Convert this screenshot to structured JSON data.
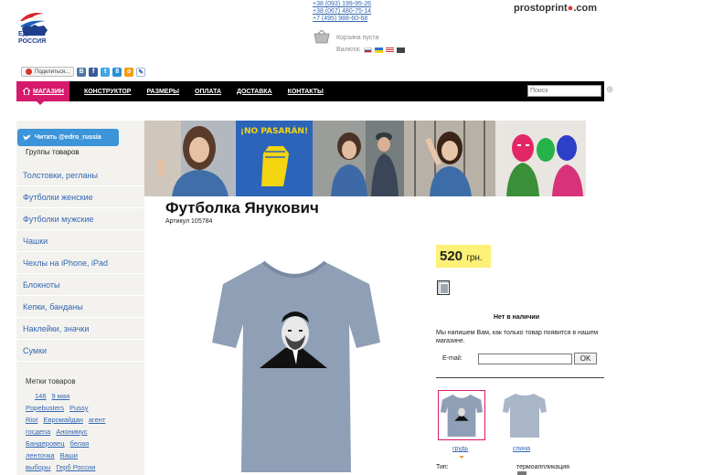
{
  "header": {
    "logo_text": "ЕДИНАЯ РОССИЯ",
    "phones": [
      "+38 (093) 199-95-26",
      "+38 (067) 480-75-14",
      "+7 (495) 988-60-68"
    ],
    "brand": "prostoprint",
    "brand_tld": ".com",
    "cart": "Корзина пуста",
    "currency_label": "Валюта:"
  },
  "share": {
    "label": "Поделиться...",
    "networks": [
      "vk",
      "facebook",
      "twitter",
      "google",
      "odnoklassniki",
      "livejournal"
    ]
  },
  "nav": {
    "items": [
      "МАГАЗИН",
      "КОНСТРУКТОР",
      "РАЗМЕРЫ",
      "ОПЛАТА",
      "ДОСТАВКА",
      "КОНТАКТЫ"
    ],
    "search_placeholder": "Поиск"
  },
  "sidebar": {
    "twitter_button": "Читать @edro_russia",
    "groups_title": "Группы товаров",
    "categories": [
      "Толстовки, регланы",
      "Футболки женские",
      "Футболки мужские",
      "Чашки",
      "Чехлы на iPhone, iPad",
      "Блокноты",
      "Кепки, банданы",
      "Наклейки, значки",
      "Сумки"
    ],
    "tags_title": "Метки товаров",
    "tags": [
      "146",
      "9 мая",
      "Popebusters",
      "Pussy",
      "Riot",
      "Евромайдан",
      "агент",
      "госдепа",
      "Анонимус",
      "Бандеровец",
      "белая",
      "ленточка",
      "Ваши",
      "выборы",
      "Герб России"
    ]
  },
  "product": {
    "title": "Футболка Янукович",
    "sku": "Артикул 105784",
    "price": "520",
    "currency": "грн.",
    "stock": "Нет в наличии",
    "notify": "Мы напишем Вам, как только товар появится в нашем магазине.",
    "email_label": "E-mail:",
    "ok_label": "OK",
    "thumb_front": "грудь",
    "thumb_back": "спина",
    "type_label": "Тип:",
    "type_value": "термоаппликация"
  },
  "banner": {
    "sign_text": "¡NO PASARÁN!"
  },
  "colors": {
    "accent": "#d6196a",
    "nav_bg": "#000000",
    "link": "#3467b3",
    "price_bg": "#fdf177",
    "sidebar_bg": "#f3f2ee",
    "twitter": "#3c94d9",
    "shirt": "#8e9fb6"
  }
}
